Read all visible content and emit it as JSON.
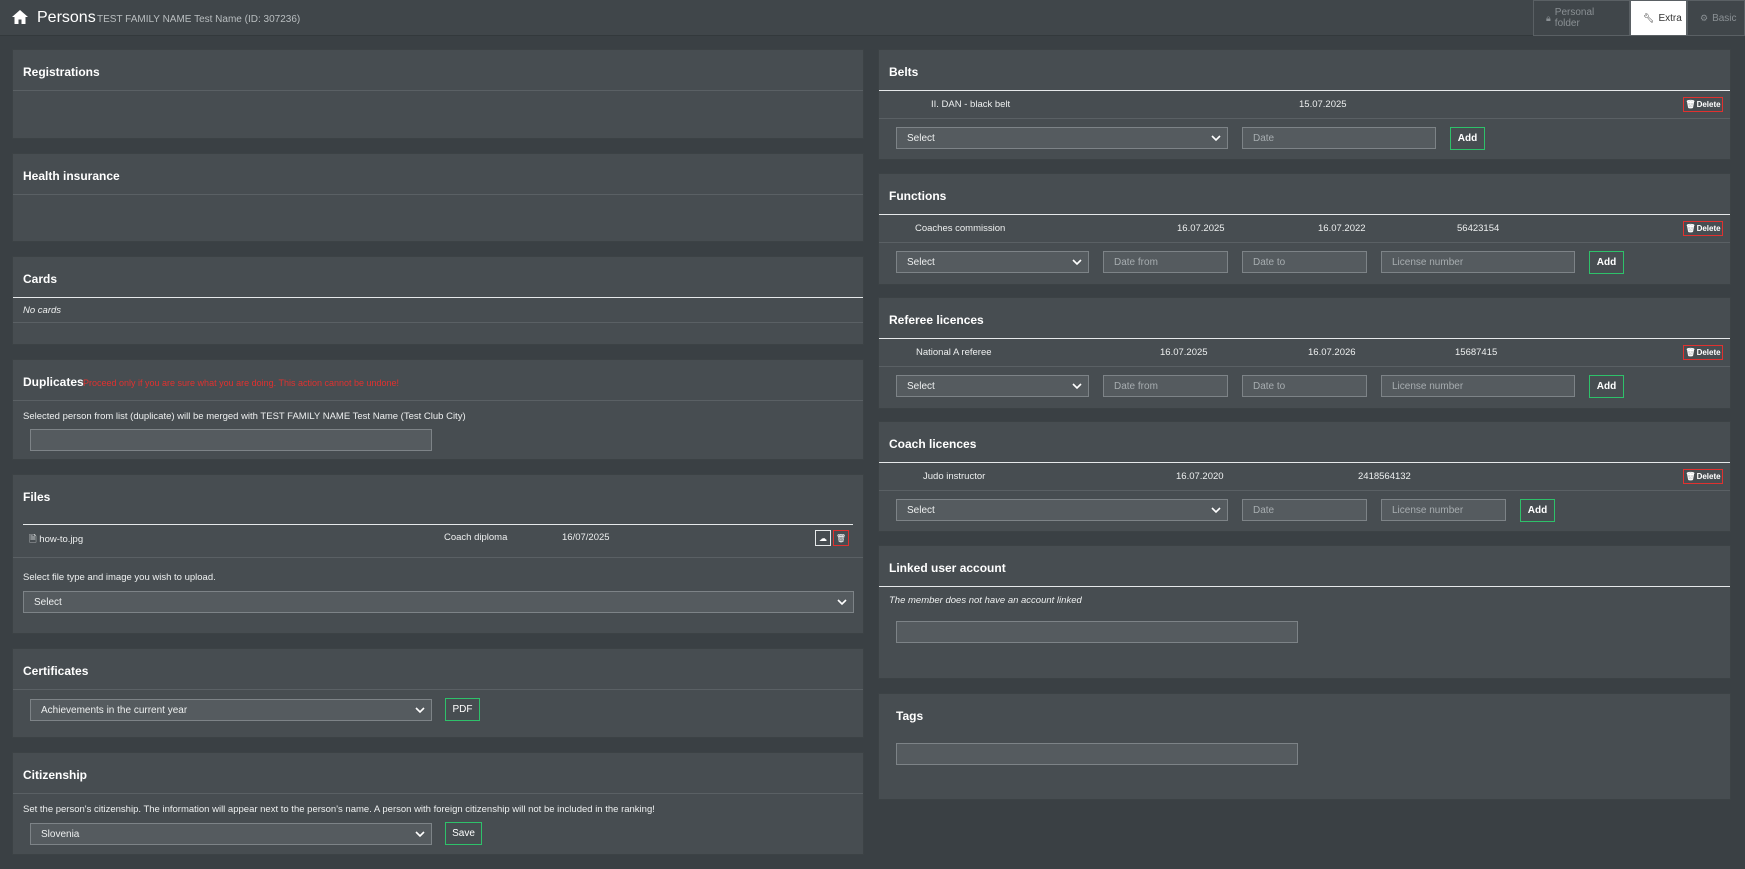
{
  "header": {
    "title": "Persons",
    "subtitle": "TEST FAMILY NAME Test Name (ID: 307236)",
    "tabs": [
      {
        "label": "Personal folder",
        "icon": "lock-icon"
      },
      {
        "label": "Extra",
        "icon": "wrench-icon"
      },
      {
        "label": "Basic",
        "icon": "gear-icon"
      }
    ]
  },
  "registrations": {
    "title": "Registrations"
  },
  "health": {
    "title": "Health insurance"
  },
  "cards": {
    "title": "Cards",
    "empty": "No cards"
  },
  "duplicates": {
    "title": "Duplicates",
    "warning": "Proceed only if you are sure what you are doing. This action cannot be undone!",
    "info": "Selected person from list (duplicate) will be merged with TEST FAMILY NAME Test Name (Test Club City)"
  },
  "files": {
    "title": "Files",
    "row": {
      "name": "how-to.jpg",
      "type": "Coach diploma",
      "date": "16/07/2025"
    },
    "instruction": "Select file type and image you wish to upload.",
    "select": "Select"
  },
  "certificates": {
    "title": "Certificates",
    "select": "Achievements in the current year",
    "button": "PDF"
  },
  "citizenship": {
    "title": "Citizenship",
    "info": "Set the person's citizenship. The information will appear next to the person's name. A person with foreign citizenship will not be included in the ranking!",
    "select": "Slovenia",
    "button": "Save"
  },
  "belts": {
    "title": "Belts",
    "row": {
      "name": "II. DAN - black belt",
      "date": "15.07.2025"
    },
    "select": "Select",
    "date_placeholder": "Date",
    "add": "Add",
    "delete": "Delete"
  },
  "functions": {
    "title": "Functions",
    "row": {
      "name": "Coaches commission",
      "from": "16.07.2025",
      "to": "16.07.2022",
      "license": "56423154"
    },
    "select": "Select",
    "from_placeholder": "Date from",
    "to_placeholder": "Date to",
    "license_placeholder": "License number",
    "add": "Add",
    "delete": "Delete"
  },
  "referee": {
    "title": "Referee licences",
    "row": {
      "name": "National A referee",
      "from": "16.07.2025",
      "to": "16.07.2026",
      "license": "15687415"
    },
    "select": "Select",
    "from_placeholder": "Date from",
    "to_placeholder": "Date to",
    "license_placeholder": "License number",
    "add": "Add",
    "delete": "Delete"
  },
  "coach": {
    "title": "Coach licences",
    "row": {
      "name": "Judo instructor",
      "date": "16.07.2020",
      "license": "2418564132"
    },
    "select": "Select",
    "date_placeholder": "Date",
    "license_placeholder": "License number",
    "add": "Add",
    "delete": "Delete"
  },
  "linked": {
    "title": "Linked user account",
    "empty": "The member does not have an account linked"
  },
  "tags": {
    "title": "Tags"
  },
  "colors": {
    "background": "#3a4044",
    "panel": "#474d51",
    "accent_green": "#2ec16a",
    "danger_red": "#e0312f"
  }
}
